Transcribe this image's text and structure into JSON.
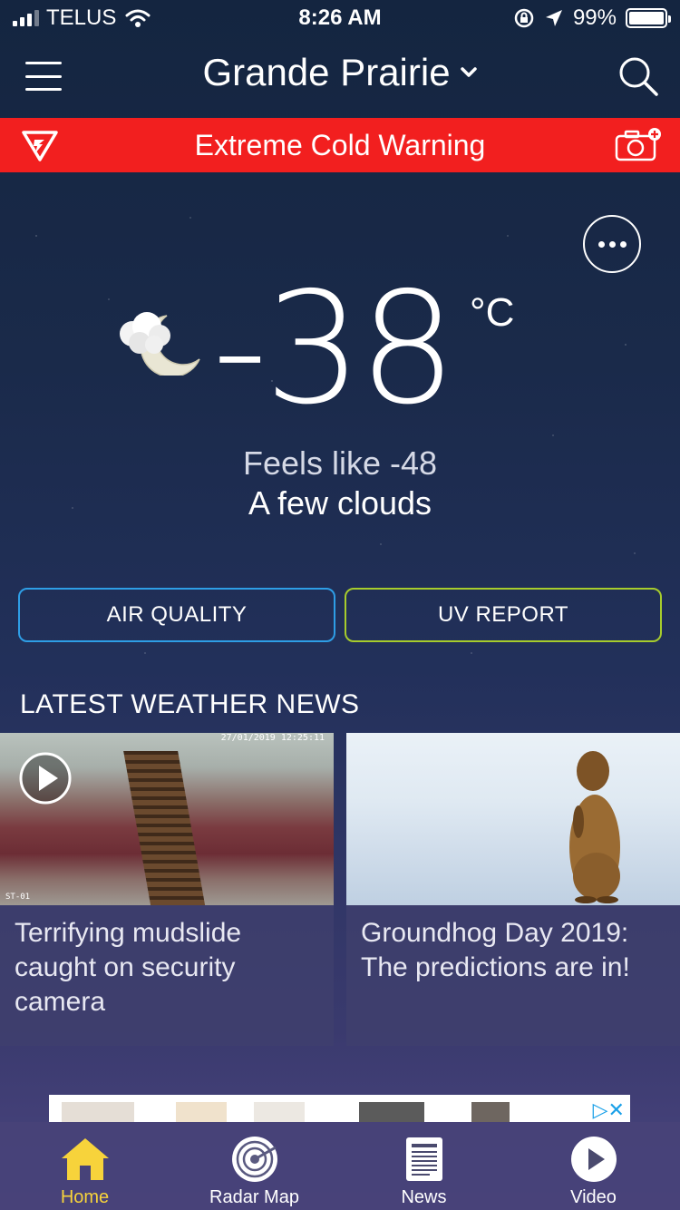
{
  "status_bar": {
    "carrier": "TELUS",
    "time": "8:26 AM",
    "battery": "99%"
  },
  "header": {
    "location": "Grande Prairie"
  },
  "alert": {
    "text": "Extreme Cold Warning"
  },
  "current": {
    "temperature": "-38",
    "unit": "°C",
    "feels_like": "Feels like -48",
    "condition": "A few clouds",
    "icon": "cloud-moon-icon"
  },
  "buttons": {
    "air_quality": "AIR QUALITY",
    "uv_report": "UV REPORT"
  },
  "news": {
    "heading": "LATEST WEATHER NEWS",
    "items": [
      {
        "title": "Terrifying mudslide caught on security camera",
        "has_video": true,
        "timestamp": "27/01/2019 12:25:11",
        "camera": "ST-01"
      },
      {
        "title": "Groundhog Day 2019: The predictions are in!",
        "has_video": false
      }
    ]
  },
  "tabs": [
    {
      "label": "Home",
      "icon": "home-icon",
      "active": true
    },
    {
      "label": "Radar Map",
      "icon": "radar-icon",
      "active": false
    },
    {
      "label": "News",
      "icon": "news-icon",
      "active": false
    },
    {
      "label": "Video",
      "icon": "play-icon",
      "active": false
    }
  ],
  "colors": {
    "alert_red": "#f21f1f",
    "air_quality_border": "#2e9ee6",
    "uv_border": "#a7cc2c",
    "active_tab": "#f7d33b"
  }
}
